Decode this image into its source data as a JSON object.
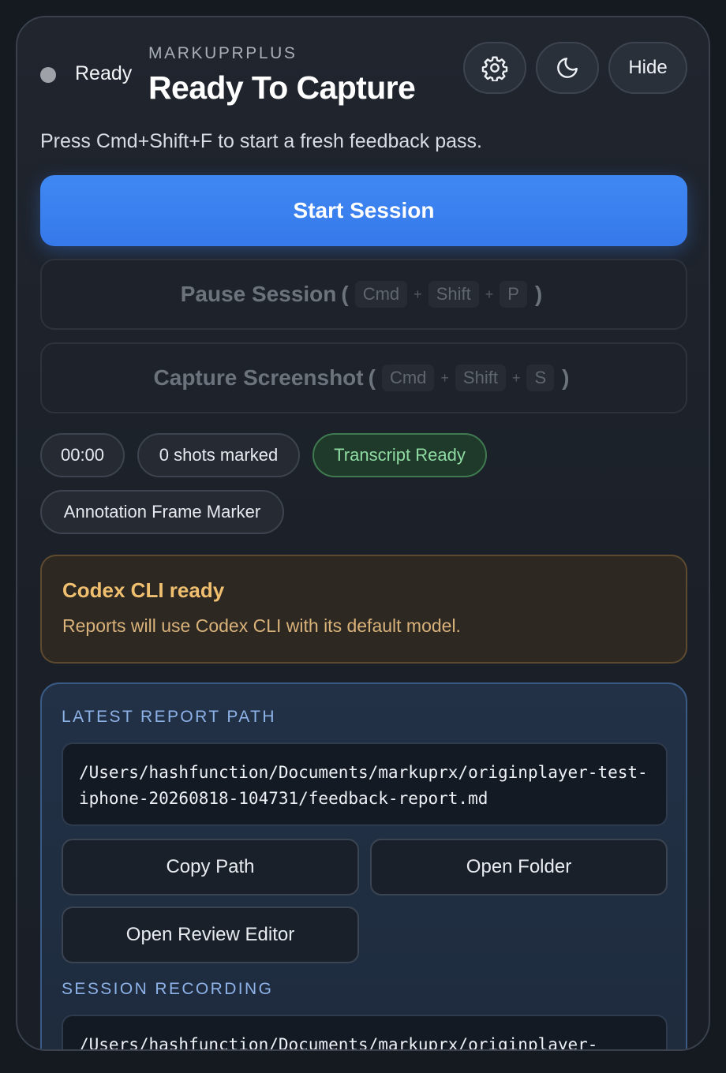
{
  "header": {
    "status_label": "Ready",
    "app_name": "MARKUPRPLUS",
    "title": "Ready To Capture",
    "settings_icon": "gear-icon",
    "theme_icon": "moon-icon",
    "hide_label": "Hide"
  },
  "subtitle": "Press Cmd+Shift+F to start a fresh feedback pass.",
  "actions": {
    "start_label": "Start Session",
    "pause": {
      "label": "Pause Session",
      "open_paren": "(",
      "close_paren": ")",
      "plus": "+",
      "keys": [
        "Cmd",
        "Shift",
        "P"
      ]
    },
    "capture": {
      "label": "Capture Screenshot",
      "open_paren": "(",
      "close_paren": ")",
      "plus": "+",
      "keys": [
        "Cmd",
        "Shift",
        "S"
      ]
    }
  },
  "chips": {
    "timer": "00:00",
    "shots": "0 shots marked",
    "transcript": "Transcript Ready",
    "marker": "Annotation Frame Marker"
  },
  "notice": {
    "title": "Codex CLI ready",
    "text": "Reports will use Codex CLI with its default model."
  },
  "report": {
    "label": "LATEST REPORT PATH",
    "path": "/Users/hashfunction/Documents/markuprx/originplayer-test-iphone-20260818-104731/feedback-report.md",
    "copy_label": "Copy Path",
    "folder_label": "Open Folder",
    "review_label": "Open Review Editor"
  },
  "recording": {
    "label": "SESSION RECORDING",
    "path": "/Users/hashfunction/Documents/markuprx/originplayer-"
  },
  "colors": {
    "accent": "#3a80ef",
    "status_dot": "#9ea2a8",
    "transcript_green": "#8fdca3",
    "notice_amber": "#f0c070",
    "section_label_blue": "#8db2e8"
  }
}
